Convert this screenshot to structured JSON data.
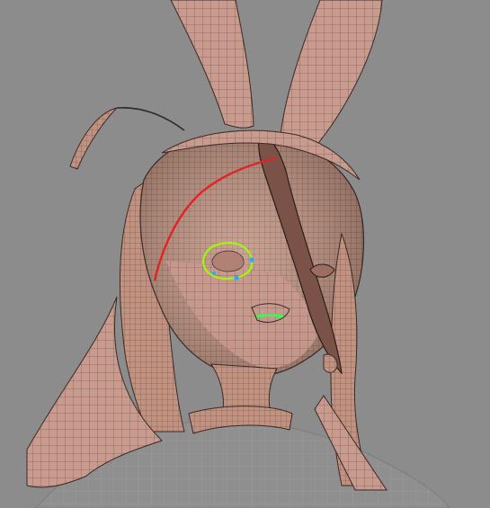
{
  "viewport": {
    "background": "#8c8c8c",
    "mesh_fill": "#c99a8e",
    "mesh_fill_dark": "#a8766b",
    "wire_color": "#3a2a26",
    "body_wire": "#9a9a9a",
    "edge_loop_red": "#e32222",
    "selection_green": "#9cff00",
    "mouth_green": "#2cff4f",
    "vertex_blue": "#2aa8ff"
  }
}
